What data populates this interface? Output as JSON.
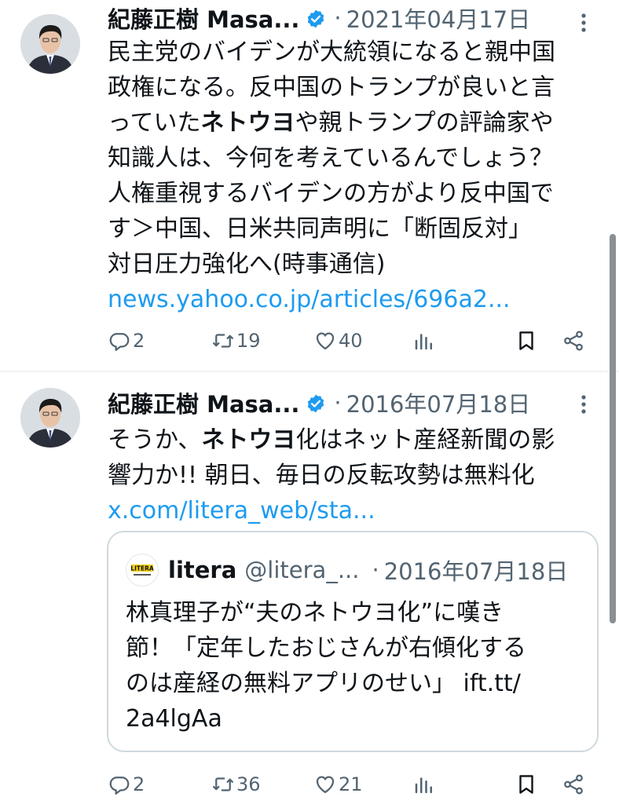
{
  "tweets": [
    {
      "author": "紀藤正樹 Masa...",
      "date": "2021年04月17日",
      "lines": [
        [
          "民主党のバイデンが大統領になると親中国"
        ],
        [
          "政権になる。反中国のトランプが良いと言"
        ],
        [
          "っていた",
          "ネトウヨ",
          "や親トランプの評論家や"
        ],
        [
          "知識人は、今何を考えているんでしょう？"
        ],
        [
          "人権重視するバイデンの方がより反中国で"
        ],
        [
          "す＞中国、日米共同声明に「断固反対」"
        ],
        [
          "対日圧力強化へ(時事通信)"
        ]
      ],
      "link": "news.yahoo.co.jp/articles/696a2...",
      "replies": "2",
      "retweets": "19",
      "likes": "40"
    },
    {
      "author": "紀藤正樹 Masa...",
      "date": "2016年07月18日",
      "lines": [
        [
          "そうか、",
          "ネトウヨ",
          "化はネット産経新聞の影"
        ],
        [
          "響力か!! 朝日、毎日の反転攻勢は無料化"
        ]
      ],
      "link": "x.com/litera_web/sta...",
      "replies": "2",
      "retweets": "36",
      "likes": "21",
      "quote": {
        "logo_text": "LITERA",
        "name": "litera",
        "handle": "@litera_...",
        "date": "2016年07月18日",
        "lines": [
          "林真理子が“夫のネトウヨ化”に嘆き",
          "節！「定年したおじさんが右傾化する",
          "のは産経の無料アプリのせい」 ift.tt/",
          "2a4lgAa"
        ]
      }
    }
  ],
  "separator": "·",
  "icons": {
    "verified": "verified-badge-icon",
    "more": "more-vertical-icon",
    "reply": "reply-icon",
    "retweet": "retweet-icon",
    "like": "heart-icon",
    "views": "views-chart-icon",
    "bookmark": "bookmark-icon",
    "share": "share-icon"
  },
  "colors": {
    "link": "#1d9bf0",
    "muted": "#536471",
    "verified": "#1d9bf0",
    "border": "#cfd9de"
  }
}
